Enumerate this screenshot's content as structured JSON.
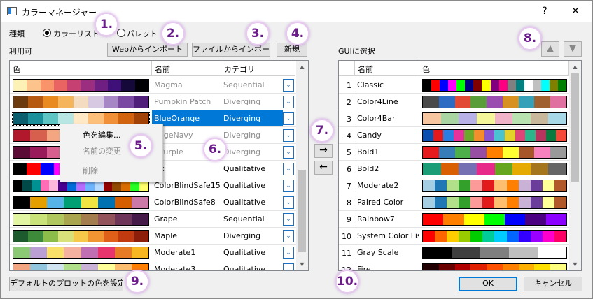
{
  "window": {
    "title": "カラーマネージャー",
    "help_label": "?",
    "close_label": "✕"
  },
  "type_label": "種類",
  "radio_colorlist": "カラーリスト",
  "radio_palette": "パレット",
  "available_label": "利用可",
  "buttons": {
    "web_import": "Webからインポート",
    "file_import": "ファイルからインポート",
    "new": "新規",
    "default_plot": "デフォルトのプロットの色を設定",
    "ok": "OK",
    "cancel": "キャンセル"
  },
  "left_table": {
    "columns": [
      "色",
      "名前",
      "カテゴリ"
    ],
    "rows": [
      {
        "name": "Magma",
        "category": "Sequential",
        "gray": true,
        "colors": [
          "#fdf2b6",
          "#fcc48c",
          "#f9946a",
          "#ea6463",
          "#c74072",
          "#9c2e7f",
          "#6e1f81",
          "#3f1077",
          "#15093a",
          "#000004"
        ]
      },
      {
        "name": "Pumpkin Patch",
        "category": "Diverging",
        "gray": true,
        "colors": [
          "#6b3a0f",
          "#b55a10",
          "#e88a1f",
          "#f5b55c",
          "#f3dcc0",
          "#d8c9e2",
          "#a686c4",
          "#7a4aa3",
          "#4f1f7a"
        ]
      },
      {
        "name": "BlueOrange",
        "category": "Diverging",
        "gray": false,
        "colors": [
          "#0b5e6e",
          "#1b8f9a",
          "#5ec5c5",
          "#b8e6e2",
          "#ffe8c5",
          "#fdc07a",
          "#f0913a",
          "#d2640f",
          "#a34206"
        ]
      },
      {
        "name": "angeNavy",
        "category": "Diverging",
        "gray": true,
        "colors": [
          "#b2182b",
          "#d6604d",
          "#f4a582",
          "#fddbc7",
          "#d1e5f0",
          "#92c5de",
          "#4393c3",
          "#2166ac"
        ]
      },
      {
        "name": "dPurple",
        "category": "Diverging",
        "gray": true,
        "colors": [
          "#5a0b36",
          "#9a1b5b",
          "#d65f8f",
          "#f2b6cc",
          "#e4cce6",
          "#b58ccf",
          "#7d53ad",
          "#4b2583"
        ]
      },
      {
        "name": "sic",
        "category": "Qualitative",
        "gray": false,
        "colors": [
          "#000000",
          "#ff0000",
          "#0000ff",
          "#ff00ff",
          "#8000ff",
          "#000080",
          "#800000",
          "#ffff00",
          "#008080",
          "#00ffff"
        ]
      },
      {
        "name": "ColorBlindSafe15",
        "category": "Qualitative",
        "gray": false,
        "colors": [
          "#000000",
          "#004949",
          "#009292",
          "#ff6db6",
          "#ffb6db",
          "#490092",
          "#006ddb",
          "#b66dff",
          "#6db6ff",
          "#b6dbff",
          "#920000",
          "#924900",
          "#db6d00",
          "#24ff24",
          "#ffff6d"
        ]
      },
      {
        "name": "ColorBlindSafe8",
        "category": "Qualitative",
        "gray": false,
        "colors": [
          "#000000",
          "#e69f00",
          "#56b4e9",
          "#009e73",
          "#f0e442",
          "#0072b2",
          "#d55e00",
          "#cc79a7"
        ]
      },
      {
        "name": "Grape",
        "category": "Sequential",
        "gray": false,
        "colors": [
          "#e2f5a3",
          "#c9e27a",
          "#b0c75f",
          "#a9a44e",
          "#a47d4f",
          "#92545a",
          "#6e3558",
          "#451a49"
        ]
      },
      {
        "name": "Maple",
        "category": "Diverging",
        "gray": false,
        "colors": [
          "#1d5a2e",
          "#3d8a3a",
          "#8cbc4a",
          "#d9e27a",
          "#f6c94b",
          "#f19432",
          "#e0601a",
          "#c23a0f",
          "#8d1f0a"
        ]
      },
      {
        "name": "Moderate1",
        "category": "Qualitative",
        "gray": false,
        "colors": [
          "#8cc974",
          "#b99fd4",
          "#f9e169",
          "#f5b1a0",
          "#c06fb2",
          "#e8356d",
          "#e87b25",
          "#f8b722"
        ]
      },
      {
        "name": "Moderate3",
        "category": "Qualitative",
        "gray": false,
        "colors": [
          "#f4a582",
          "#92c5de",
          "#d1e5f0",
          "#b2df8a",
          "#cab2d6",
          "#ffff99",
          "#fdbf6f",
          "#ff7f00"
        ]
      }
    ]
  },
  "context_menu": {
    "edit": "色を編集...",
    "rename": "名前の変更",
    "delete": "削除"
  },
  "gui_label": "GUIに選択",
  "right_table": {
    "columns": [
      "名前",
      "色"
    ],
    "rows": [
      {
        "n": "1",
        "name": "Classic",
        "colors": [
          "#000000",
          "#ff0000",
          "#0000ff",
          "#ff00ff",
          "#00ff00",
          "#000080",
          "#800000",
          "#ffff00",
          "#800080",
          "#ff0080",
          "#808080",
          "#008080",
          "#ffffff",
          "#c0c0c0",
          "#00ffff",
          "#808000",
          "#008000"
        ]
      },
      {
        "n": "2",
        "name": "Color4Line",
        "colors": [
          "#4a4a4a",
          "#2e6cc4",
          "#e34a35",
          "#5a9e3a",
          "#9a4fb0",
          "#d69120",
          "#36a0b8",
          "#a06030",
          "#e070a0"
        ]
      },
      {
        "n": "3",
        "name": "Color4Bar",
        "colors": [
          "#f7c59f",
          "#a8d5a2",
          "#b7b1e8",
          "#f5f59a",
          "#f0b3c8",
          "#b8e3b0",
          "#c9b79c",
          "#a6d8e8"
        ]
      },
      {
        "n": "4",
        "name": "Candy",
        "colors": [
          "#0a4fae",
          "#e31a1c",
          "#2a7de1",
          "#e5339b",
          "#6aaa2a",
          "#f28e2b",
          "#8854d0",
          "#4ac2d0",
          "#e4d02c",
          "#dd4477",
          "#2ab58a",
          "#b6345e",
          "#0b7a3e",
          "#f54a3a"
        ]
      },
      {
        "n": "5",
        "name": "Bold1",
        "colors": [
          "#e41a1c",
          "#377eb8",
          "#4daf4a",
          "#984ea3",
          "#ff7f00",
          "#ffff33",
          "#a65628",
          "#f781bf",
          "#999999"
        ]
      },
      {
        "n": "6",
        "name": "Bold2",
        "colors": [
          "#1b9e77",
          "#d95f02",
          "#7570b3",
          "#e7298a",
          "#66a61e",
          "#e6ab02",
          "#a6761d",
          "#666666"
        ]
      },
      {
        "n": "7",
        "name": "Moderate2",
        "colors": [
          "#a6cee3",
          "#1f78b4",
          "#b2df8a",
          "#33a02c",
          "#fb9a99",
          "#e31a1c",
          "#fdbf6f",
          "#ff7f00",
          "#cab2d6",
          "#6a3d9a",
          "#ffff99",
          "#b15928"
        ]
      },
      {
        "n": "8",
        "name": "Paired Color",
        "colors": [
          "#a6cee3",
          "#1f78b4",
          "#b2df8a",
          "#33a02c",
          "#fb9a99",
          "#e31a1c",
          "#fdbf6f",
          "#ff7f00",
          "#cab2d6",
          "#6a3d9a",
          "#ffff99",
          "#b15928"
        ]
      },
      {
        "n": "9",
        "name": "Rainbow7",
        "colors": [
          "#ff0000",
          "#ff7f00",
          "#ffff00",
          "#00ff00",
          "#0000ff",
          "#4b0082",
          "#8b00ff"
        ]
      },
      {
        "n": "10",
        "name": "System Color List",
        "colors": [
          "#ff0000",
          "#ff6600",
          "#ffcc00",
          "#99cc00",
          "#00cc00",
          "#00cc99",
          "#00ccff",
          "#0066ff",
          "#3300ff",
          "#9900ff",
          "#ff00cc",
          "#ff0066"
        ]
      },
      {
        "n": "11",
        "name": "Gray Scale",
        "colors": [
          "#000000",
          "#3f3f3f",
          "#7f7f7f",
          "#bfbfbf",
          "#ffffff"
        ]
      },
      {
        "n": "12",
        "name": "Fire",
        "colors": [
          "#200000",
          "#6b0000",
          "#b00000",
          "#e02000",
          "#ff5000",
          "#ff8000",
          "#ffb000",
          "#ffe000",
          "#ffff80"
        ]
      }
    ]
  },
  "callouts": [
    "1.",
    "2.",
    "3.",
    "4.",
    "5.",
    "6.",
    "7.",
    "8.",
    "9.",
    "10."
  ]
}
